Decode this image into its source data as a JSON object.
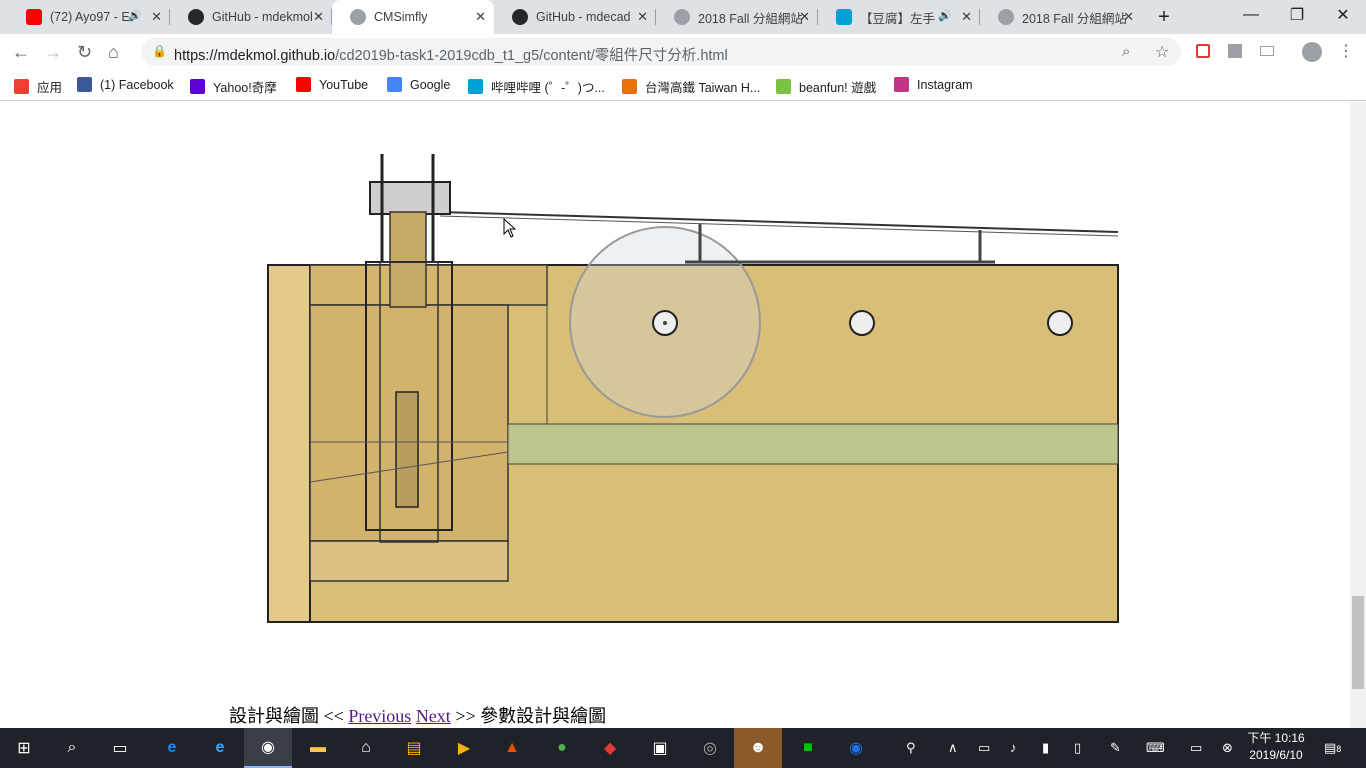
{
  "tabs": [
    {
      "title": "(72) Ayo97 - E",
      "color": "#ff0000",
      "audio": true
    },
    {
      "title": "GitHub - mdekmol",
      "color": "#24292e"
    },
    {
      "title": "CMSimfly",
      "color": "#5f6368",
      "active": true
    },
    {
      "title": "GitHub - mdecad",
      "color": "#24292e"
    },
    {
      "title": "2018 Fall 分組網站",
      "color": "#5f6368"
    },
    {
      "title": "【豆腐】左手",
      "color": "#00a1d6",
      "audio": true
    },
    {
      "title": "2018 Fall 分組網站",
      "color": "#5f6368"
    }
  ],
  "window": {
    "minimize": "—",
    "maximize": "❐",
    "close": "✕",
    "new_tab": "+"
  },
  "address": {
    "host": "https://mdekmol.github.io",
    "path": "/cd2019b-task1-2019cdb_t1_g5/content/零組件尺寸分析.html"
  },
  "bookmarks": [
    {
      "label": "应用",
      "icon": "apps-icon",
      "color": "#e94235"
    },
    {
      "label": "(1) Facebook",
      "icon": "facebook-icon",
      "color": "#3b5998"
    },
    {
      "label": "Yahoo!奇摩",
      "icon": "yahoo-icon",
      "color": "#5f01d1"
    },
    {
      "label": "YouTube",
      "icon": "youtube-icon",
      "color": "#ff0000"
    },
    {
      "label": "Google",
      "icon": "google-icon",
      "color": "#4285f4"
    },
    {
      "label": "哔哩哔哩 (゜-゜)つ...",
      "icon": "bilibili-icon",
      "color": "#00a1d6"
    },
    {
      "label": "台灣高鐵 Taiwan H...",
      "icon": "thsr-icon",
      "color": "#e8710a"
    },
    {
      "label": "beanfun! 遊戲",
      "icon": "beanfun-icon",
      "color": "#7cc242"
    },
    {
      "label": "Instagram",
      "icon": "instagram-icon",
      "color": "#c13584"
    }
  ],
  "page": {
    "nav_prev_text": "設計與繪圖 <<",
    "previous": "Previous",
    "next": "Next",
    "nav_next_text": ">> 參數設計與繪圖"
  },
  "clock": {
    "time": "下午 10:16",
    "date": "2019/6/10"
  },
  "notifications": "8"
}
